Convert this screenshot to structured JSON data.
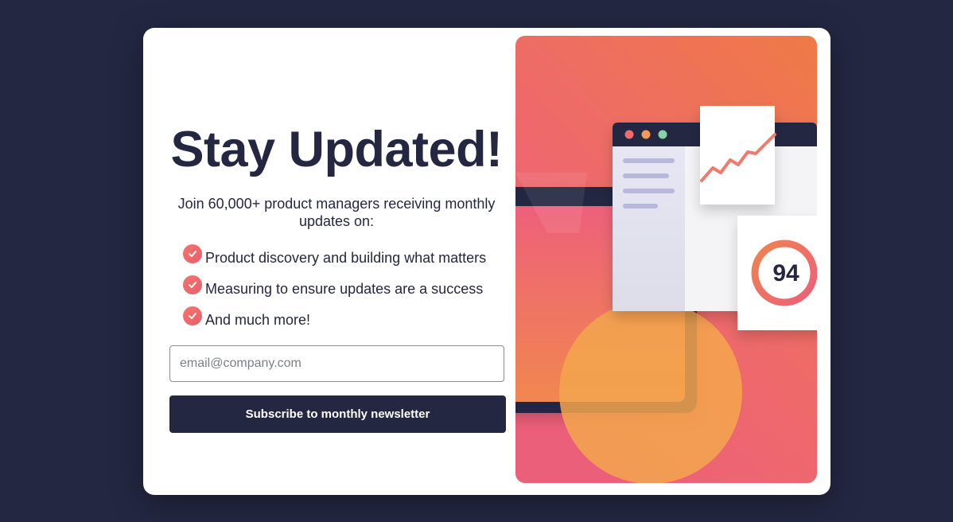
{
  "signup": {
    "title": "Stay Updated!",
    "intro": "Join 60,000+ product managers receiving monthly updates on:",
    "features": [
      "Product discovery and building what matters",
      "Measuring to ensure updates are a success",
      "And much more!"
    ],
    "email_placeholder": "email@company.com",
    "email_value": "",
    "subscribe_label": "Subscribe to monthly newsletter"
  },
  "illustration": {
    "score": "94"
  },
  "colors": {
    "page_background": "#242742",
    "accent_navy": "#242742",
    "accent_tomato": "#ff6155",
    "gradient_top": "#ef7a46",
    "gradient_bottom": "#ec5f7a"
  },
  "icons": {
    "check": "check-circle-icon",
    "window_dots": [
      "red-dot",
      "orange-dot",
      "green-dot"
    ]
  }
}
